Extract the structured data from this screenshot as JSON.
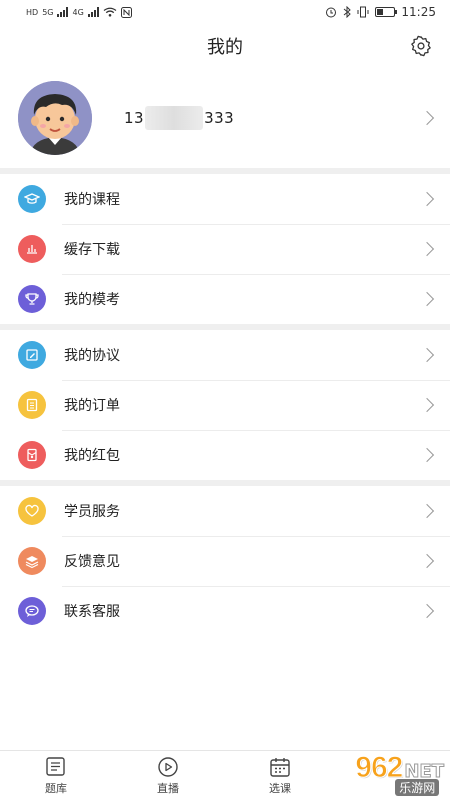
{
  "status_bar": {
    "left_indicators": [
      "HD",
      "5G",
      "4G"
    ],
    "time": "11:25"
  },
  "header": {
    "title": "我的"
  },
  "profile": {
    "phone_prefix": "13",
    "phone_suffix": "333"
  },
  "menu_groups": [
    {
      "items": [
        {
          "label": "我的课程",
          "icon": "graduation-cap-icon",
          "color": "#3fa9e0"
        },
        {
          "label": "缓存下载",
          "icon": "bar-chart-icon",
          "color": "#ee5d5d"
        },
        {
          "label": "我的模考",
          "icon": "trophy-icon",
          "color": "#6d5fd8"
        }
      ]
    },
    {
      "items": [
        {
          "label": "我的协议",
          "icon": "edit-document-icon",
          "color": "#3fa9e0"
        },
        {
          "label": "我的订单",
          "icon": "list-document-icon",
          "color": "#f6c33e"
        },
        {
          "label": "我的红包",
          "icon": "red-envelope-icon",
          "color": "#ee5d5d"
        }
      ]
    },
    {
      "items": [
        {
          "label": "学员服务",
          "icon": "heart-icon",
          "color": "#f6c33e"
        },
        {
          "label": "反馈意见",
          "icon": "feedback-stack-icon",
          "color": "#ef8a5e"
        },
        {
          "label": "联系客服",
          "icon": "chat-bubble-icon",
          "color": "#6d5fd8"
        }
      ]
    }
  ],
  "bottom_tabs": [
    {
      "label": "题库",
      "icon": "question-bank-icon"
    },
    {
      "label": "直播",
      "icon": "play-circle-icon"
    },
    {
      "label": "选课",
      "icon": "calendar-icon"
    }
  ],
  "watermark": {
    "number": "962",
    "net": "NET",
    "sub": "乐游网"
  }
}
